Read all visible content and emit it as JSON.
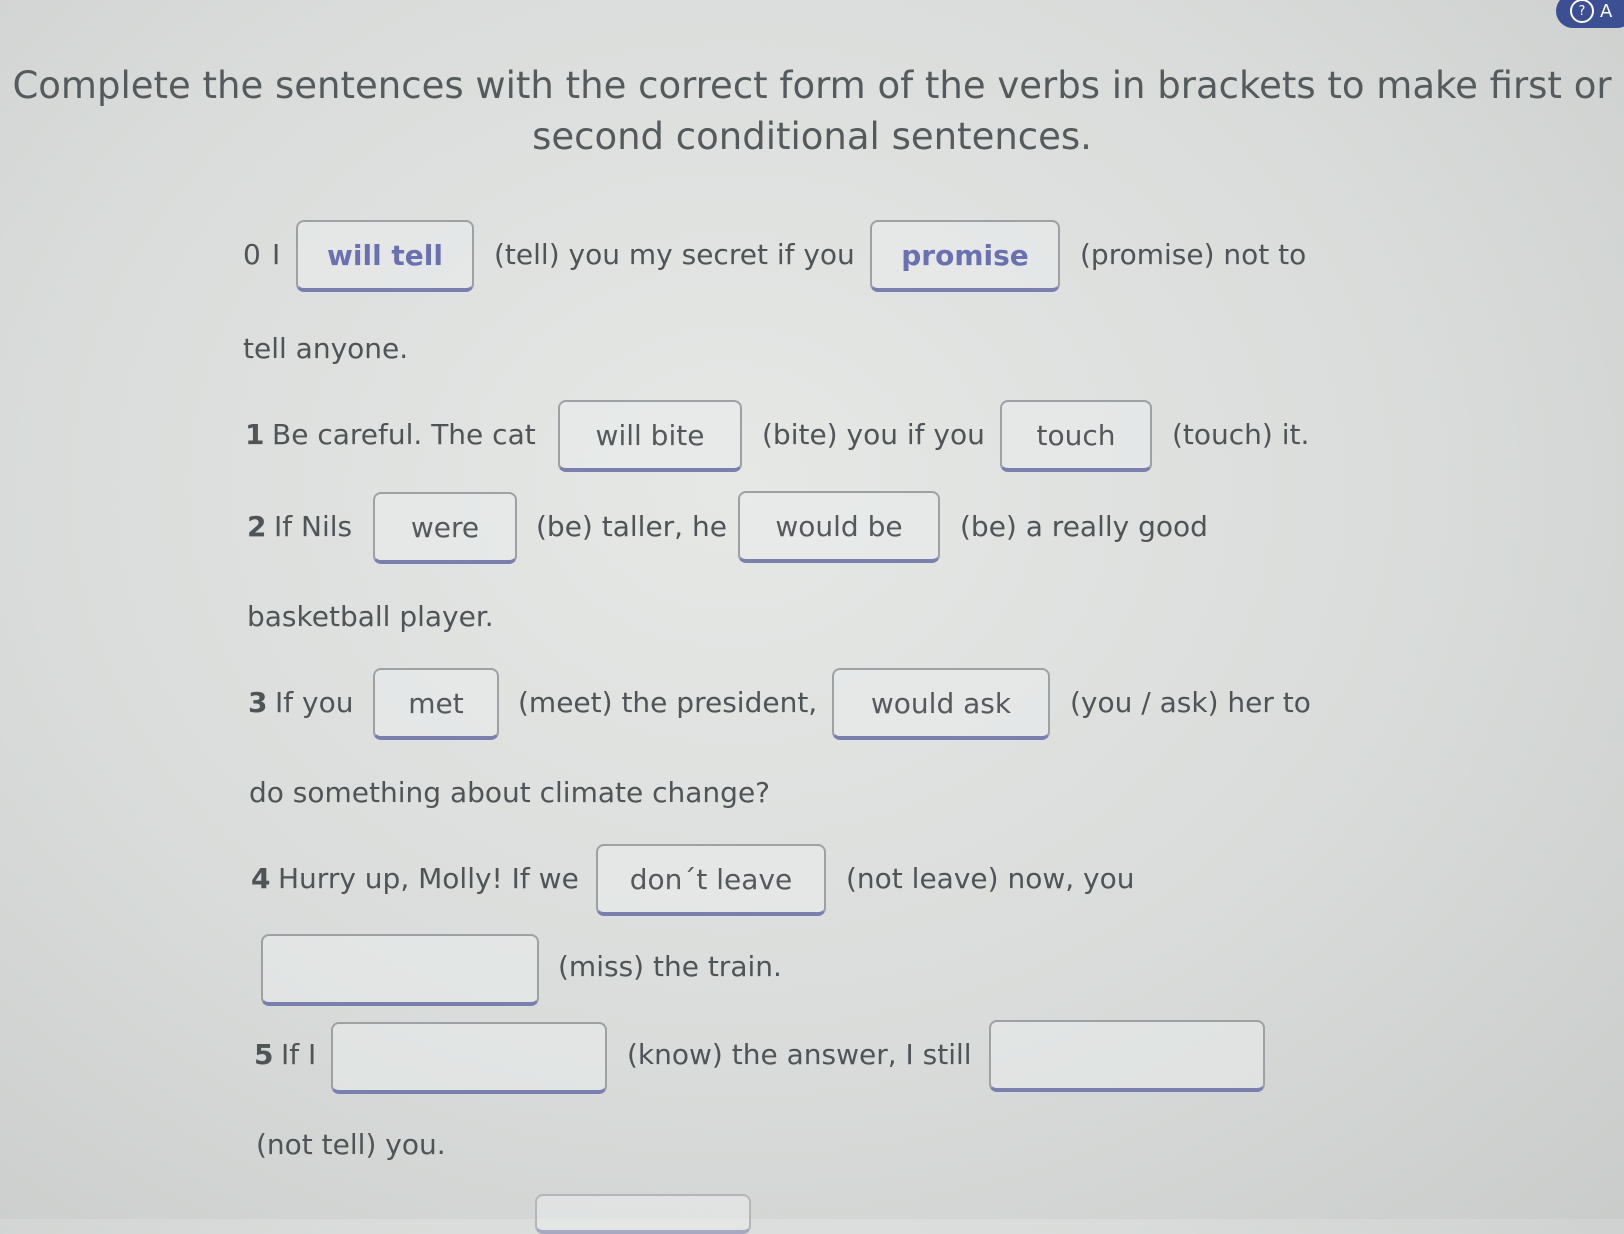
{
  "corner": {
    "help_symbol": "?",
    "label": "A"
  },
  "instructions": "Complete the sentences with the correct form of the verbs in brackets to make first or second conditional sentences.",
  "items": [
    {
      "number": "0",
      "parts": [
        "I",
        "(tell) you my secret if you",
        "(promise) not to",
        "tell anyone."
      ],
      "answers": [
        "will tell",
        "promise"
      ]
    },
    {
      "number": "1",
      "parts": [
        "Be careful. The cat",
        "(bite) you if you",
        "(touch) it."
      ],
      "answers": [
        "will bite",
        "touch"
      ]
    },
    {
      "number": "2",
      "parts": [
        "If Nils",
        "(be) taller, he",
        "(be) a really good",
        "basketball player."
      ],
      "answers": [
        "were",
        "would be"
      ]
    },
    {
      "number": "3",
      "parts": [
        "If you",
        "(meet) the president,",
        "(you / ask) her to",
        "do something about climate change?"
      ],
      "answers": [
        "met",
        "would ask"
      ]
    },
    {
      "number": "4",
      "parts": [
        "Hurry up, Molly! If we",
        "(not leave) now, you",
        "(miss) the train."
      ],
      "answers": [
        "don´t leave",
        ""
      ]
    },
    {
      "number": "5",
      "parts": [
        "If I",
        "(know) the answer, I still",
        "(not tell) you."
      ],
      "answers": [
        "",
        ""
      ]
    }
  ]
}
